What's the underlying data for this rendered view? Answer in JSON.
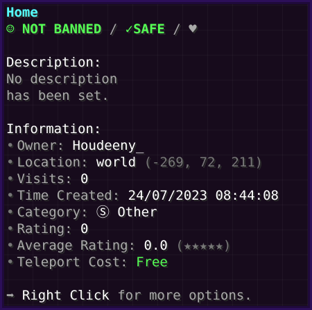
{
  "tooltip": {
    "title": "Home",
    "status": {
      "banned_icon": "☺",
      "banned_text": "NOT BANNED",
      "separator": "/",
      "safe_icon": "✓",
      "safe_text": "SAFE",
      "heart_icon": "♥"
    },
    "description": {
      "heading": "Description:",
      "lines": [
        "No description",
        "has been set."
      ]
    },
    "information": {
      "heading": "Information:",
      "bullet": "•",
      "owner_label": "Owner:",
      "owner_value": "Houdeeny_",
      "location_label": "Location:",
      "location_world": "world",
      "location_coords": "(-269, 72, 211)",
      "visits_label": "Visits:",
      "visits_value": "0",
      "time_label": "Time Created:",
      "time_value": "24/07/2023 08:44:08",
      "category_label": "Category:",
      "category_icon": "Ⓢ",
      "category_value": "Other",
      "rating_label": "Rating:",
      "rating_value": "0",
      "avg_rating_label": "Average Rating:",
      "avg_rating_value": "0.0",
      "avg_rating_stars": "(★★★★★)",
      "teleport_label": "Teleport Cost:",
      "teleport_value": "Free"
    },
    "footer": {
      "arrow": "➡",
      "action": "Right Click",
      "rest": "for more options."
    },
    "colors": {
      "background": "#170b1c",
      "border": "#2c0f59",
      "title": "#55ffff",
      "green": "#55ff55",
      "gray": "#aaaaaa",
      "dark_gray": "#777777",
      "white": "#ffffff"
    }
  }
}
